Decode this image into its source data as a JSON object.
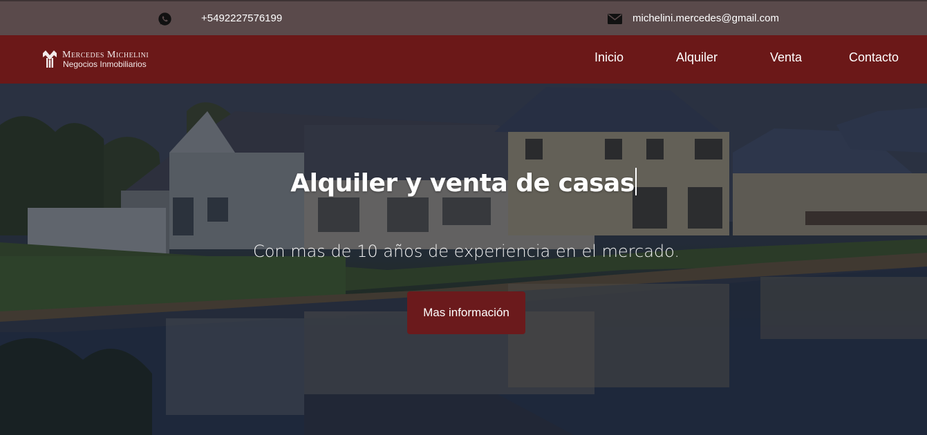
{
  "topbar": {
    "whatsapp_icon": "whatsapp-icon",
    "phone": "+5492227576199",
    "mail_icon": "envelope-icon",
    "email": "michelini.mercedes@gmail.com"
  },
  "brand": {
    "name": "Mercedes Michelini",
    "tagline": "Negocios Inmobiliarios"
  },
  "nav": {
    "items": [
      {
        "label": "Inicio"
      },
      {
        "label": "Alquiler"
      },
      {
        "label": "Venta"
      },
      {
        "label": "Contacto"
      }
    ]
  },
  "hero": {
    "title": "Alquiler y venta de casas",
    "subtitle": "Con mas de 10 años de experiencia en el mercado.",
    "button_label": "Mas información"
  },
  "colors": {
    "topbar_bg": "#5a4a4b",
    "navbar_bg": "#6b1818",
    "button_bg": "#6b1a1c"
  }
}
